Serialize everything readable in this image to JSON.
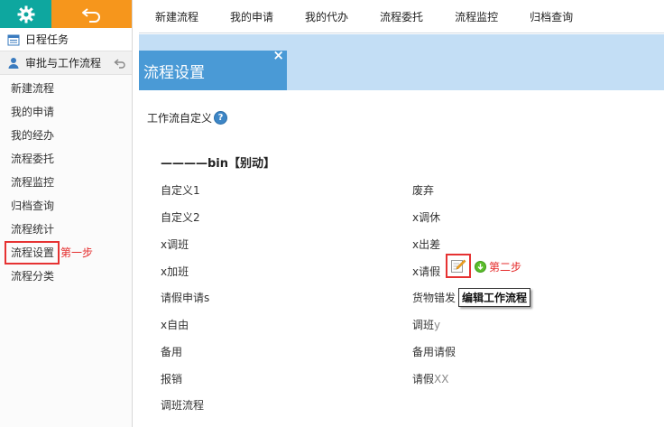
{
  "sidebar": {
    "section1": "日程任务",
    "section2": "审批与工作流程",
    "items": [
      {
        "label": "新建流程"
      },
      {
        "label": "我的申请"
      },
      {
        "label": "我的经办"
      },
      {
        "label": "流程委托"
      },
      {
        "label": "流程监控"
      },
      {
        "label": "归档查询"
      },
      {
        "label": "流程统计"
      },
      {
        "label": "流程设置"
      },
      {
        "label": "流程分类"
      }
    ],
    "step1_label": "第一步"
  },
  "topnav": {
    "items": [
      "新建流程",
      "我的申请",
      "我的代办",
      "流程委托",
      "流程监控",
      "归档查询"
    ]
  },
  "panel": {
    "title": "流程设置",
    "close": "×"
  },
  "content": {
    "header": "工作流自定义",
    "help": "?",
    "group_title": "————bin【别动】",
    "left_col": [
      "自定义1",
      "自定义2",
      "x调班",
      "x加班",
      "请假申请s",
      "x自由",
      "备用",
      "报销",
      "调班流程"
    ],
    "right_col": [
      {
        "main": "废弃",
        "suffix": ""
      },
      {
        "main": "x调休",
        "suffix": ""
      },
      {
        "main": "x出差",
        "suffix": ""
      },
      {
        "main": "x请假",
        "suffix": ""
      },
      {
        "main": "货物错发",
        "suffix": ""
      },
      {
        "main": "调班",
        "suffix": "y"
      },
      {
        "main": "备用请假",
        "suffix": ""
      },
      {
        "main": "请假",
        "suffix": "XX"
      }
    ],
    "step2_label": "第二步",
    "tooltip": "编辑工作流程"
  },
  "colors": {
    "accent_teal": "#0ea79f",
    "accent_orange": "#f6961c",
    "band_blue": "#c3def5",
    "tab_blue": "#4a9ad6",
    "highlight_red": "#e63232"
  }
}
